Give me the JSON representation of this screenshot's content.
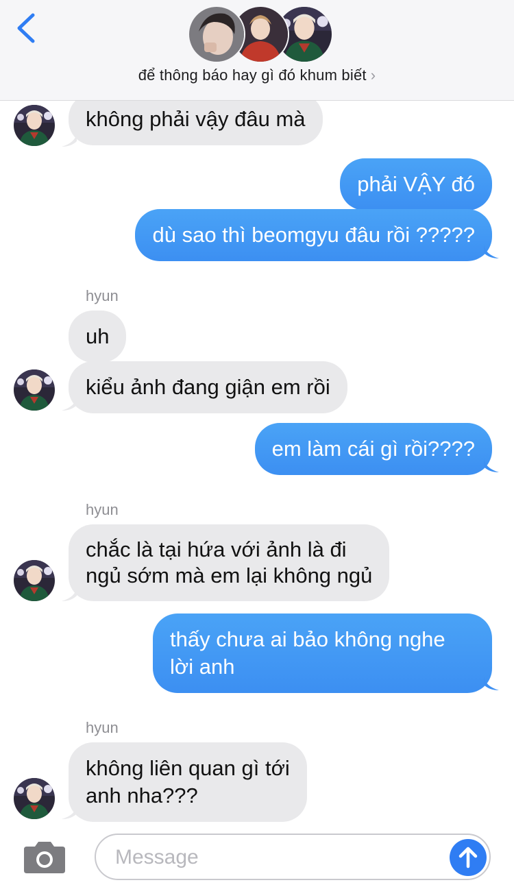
{
  "header": {
    "back_icon": "chevron-left-icon",
    "group_title": "để thông báo hay gì đó khum biết",
    "title_chevron": "›",
    "avatar_count": 3
  },
  "messages": [
    {
      "dir": "in",
      "text": "không phải vậy đâu mà"
    },
    {
      "dir": "out",
      "text": "phải VẬY đó"
    },
    {
      "dir": "out",
      "text": "dù sao thì beomgyu đâu rồi ?????"
    },
    {
      "dir": "in",
      "sender": "hyun",
      "text": "uh"
    },
    {
      "dir": "in",
      "text": "kiểu ảnh đang giận em rồi"
    },
    {
      "dir": "out",
      "text": "em làm cái gì rồi????"
    },
    {
      "dir": "in",
      "sender": "hyun",
      "lines": [
        "chắc là tại hứa với ảnh là đi",
        "ngủ sớm mà em lại không ngủ"
      ]
    },
    {
      "dir": "out",
      "lines": [
        "thấy chưa ai bảo không nghe",
        "lời anh"
      ]
    },
    {
      "dir": "in",
      "sender": "hyun",
      "lines": [
        "không liên quan gì tới",
        "anh nha???"
      ]
    }
  ],
  "input": {
    "placeholder": "Message",
    "camera_icon": "camera-icon",
    "send_icon": "arrow-up-icon"
  },
  "colors": {
    "outgoing_bubble": "#3d8ff2",
    "incoming_bubble": "#e9e9eb",
    "accent": "#2f7df3",
    "header_bg": "#f6f6f8"
  }
}
